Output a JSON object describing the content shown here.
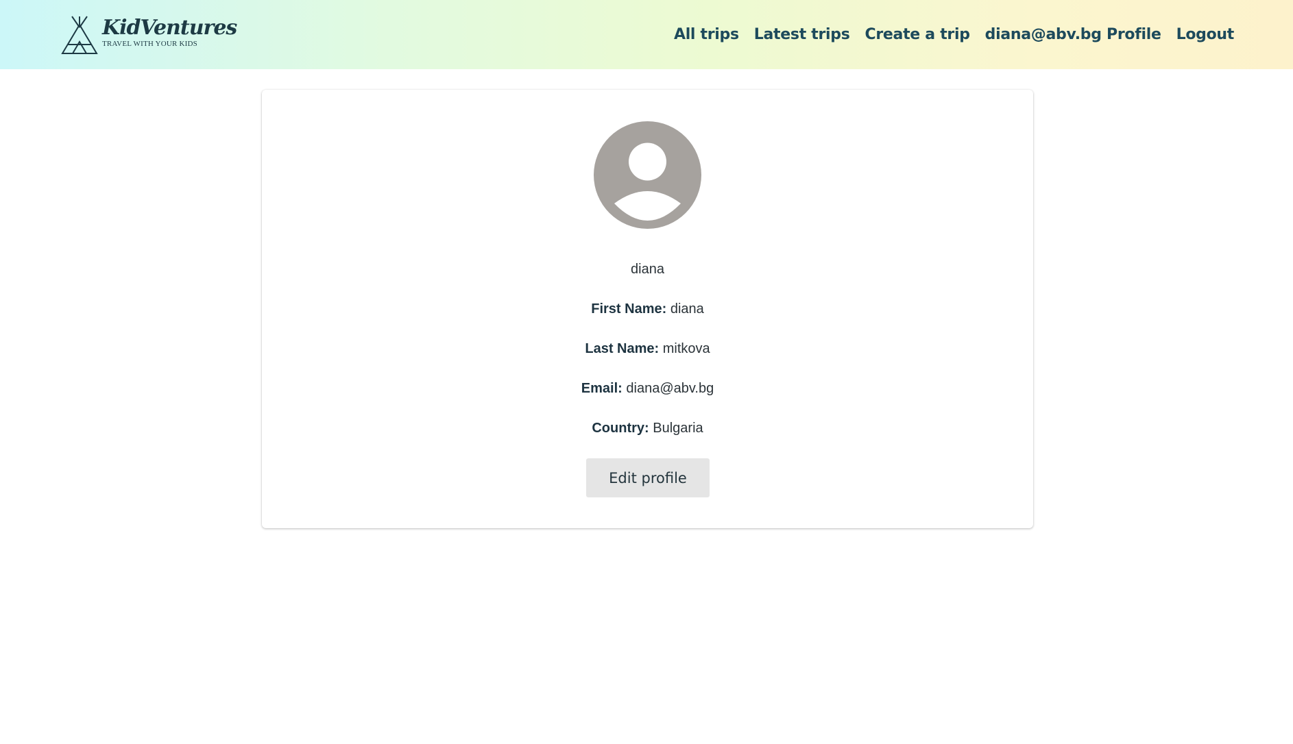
{
  "header": {
    "logo": {
      "title": "KidVentures",
      "tagline": "TRAVEL WITH YOUR KIDS",
      "icon": "teepee-icon"
    },
    "nav": [
      {
        "label": "All trips"
      },
      {
        "label": "Latest trips"
      },
      {
        "label": "Create a trip"
      },
      {
        "label": "diana@abv.bg Profile"
      },
      {
        "label": "Logout"
      }
    ]
  },
  "profile": {
    "avatar_icon": "user-avatar-icon",
    "username": "diana",
    "fields": [
      {
        "label": "First Name:",
        "value": "diana"
      },
      {
        "label": "Last Name:",
        "value": "mitkova"
      },
      {
        "label": "Email:",
        "value": "diana@abv.bg"
      },
      {
        "label": "Country:",
        "value": "Bulgaria"
      }
    ],
    "edit_button_label": "Edit profile"
  },
  "colors": {
    "header_gradient_start": "#ccf7f8",
    "header_gradient_end": "#fdf2cc",
    "nav_text": "#1d4a5c",
    "avatar_gray": "#a6a29e",
    "button_bg": "#e5e5e5"
  }
}
